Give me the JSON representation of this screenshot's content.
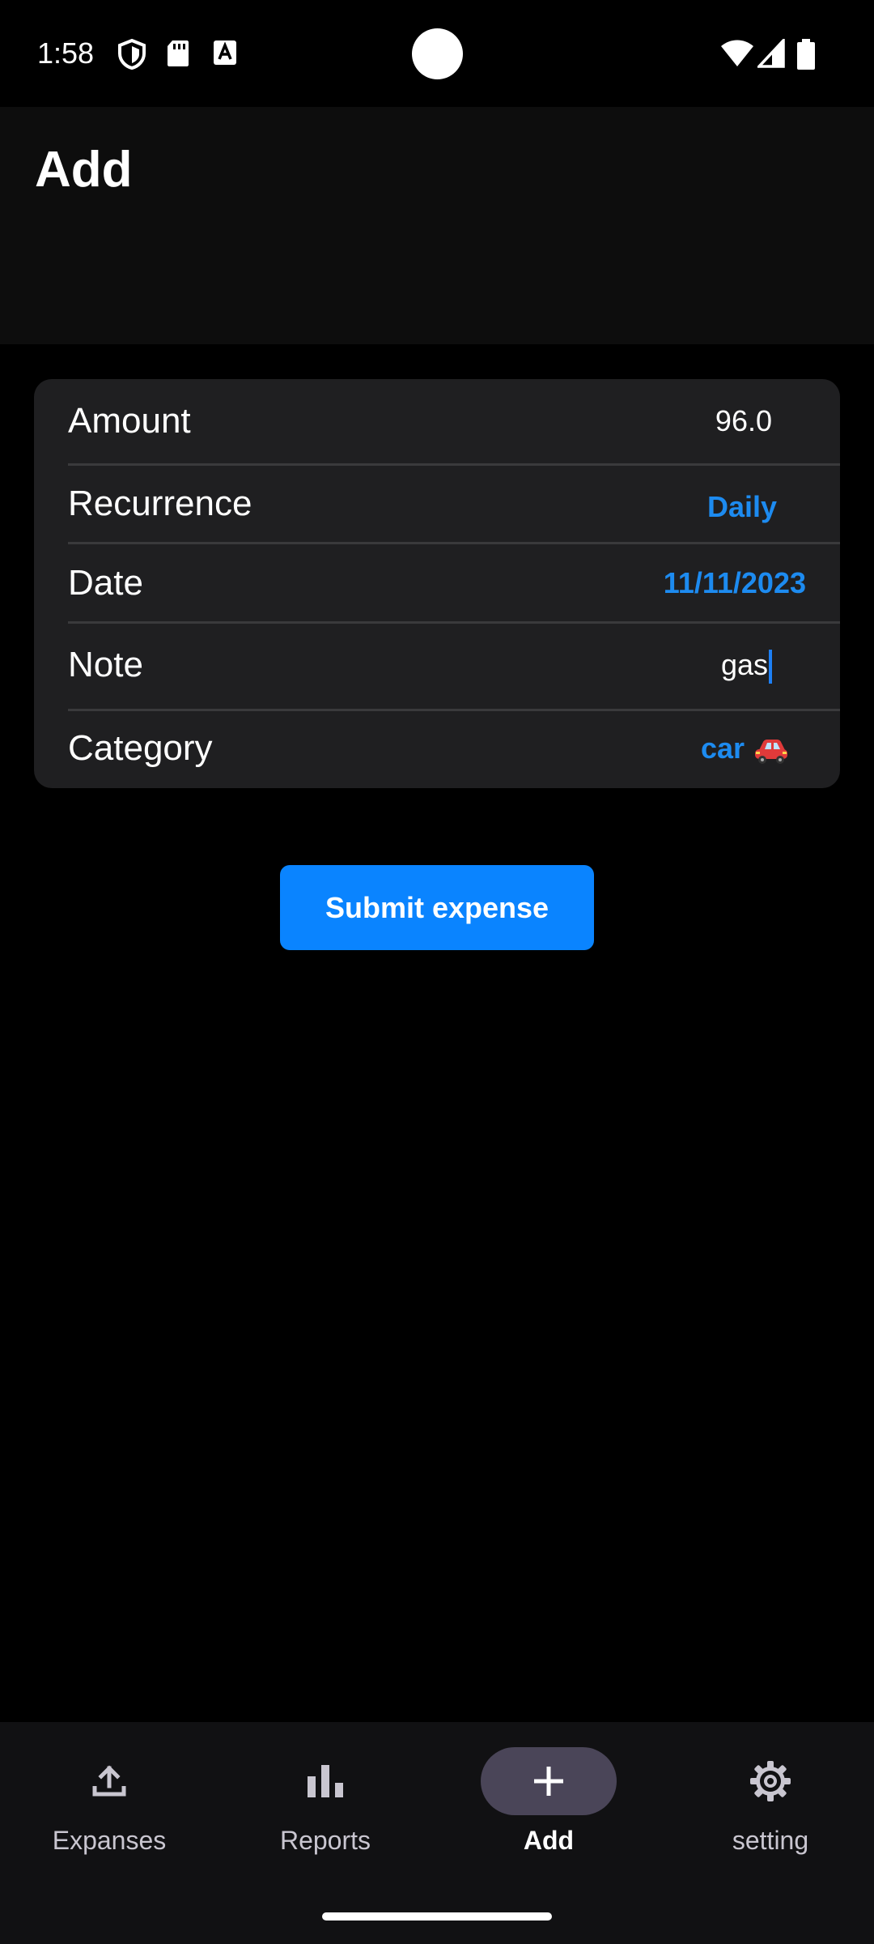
{
  "status_bar": {
    "time": "1:58",
    "left_icons": [
      "shield-icon",
      "sd-card-icon",
      "keyboard-a-icon"
    ],
    "right_icons": [
      "wifi-icon",
      "signal-icon",
      "battery-icon"
    ]
  },
  "app_bar": {
    "title": "Add"
  },
  "form": {
    "rows": [
      {
        "label": "Amount",
        "value": "96.0"
      },
      {
        "label": "Recurrence",
        "value": "Daily"
      },
      {
        "label": "Date",
        "value": "11/11/2023"
      },
      {
        "label": "Note",
        "value": "gas"
      },
      {
        "label": "Category",
        "value": "car",
        "value_icon": "car-icon"
      }
    ]
  },
  "submit": {
    "label": "Submit expense"
  },
  "bottom_nav": {
    "items": [
      {
        "label": "Expanses",
        "icon": "upload-icon",
        "active": false
      },
      {
        "label": "Reports",
        "icon": "bar-chart-icon",
        "active": false
      },
      {
        "label": "Add",
        "icon": "plus-icon",
        "active": true
      },
      {
        "label": "setting",
        "icon": "gear-icon",
        "active": false
      }
    ]
  },
  "colors": {
    "accent": "#0a84ff",
    "link_value": "#1d8bf0",
    "card_bg": "#1f1f21",
    "nav_active_pill": "#4a4558"
  }
}
